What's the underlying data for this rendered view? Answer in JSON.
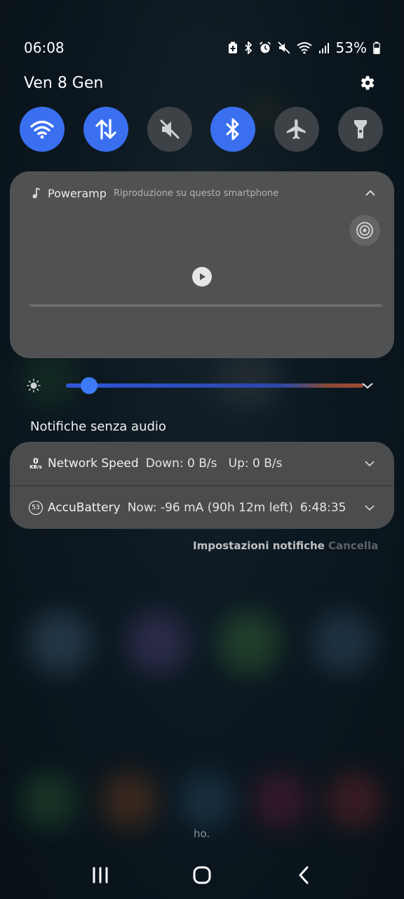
{
  "status_bar": {
    "time": "06:08",
    "battery_percent": "53%",
    "icons": [
      "battery-saver-icon",
      "bluetooth-icon",
      "alarm-icon",
      "mute-icon",
      "wifi-icon",
      "signal-icon",
      "battery-icon"
    ]
  },
  "header": {
    "date": "Ven 8 Gen",
    "settings_icon": "gear-icon"
  },
  "quick_toggles": [
    {
      "name": "wifi",
      "icon": "wifi-icon",
      "state": "on"
    },
    {
      "name": "mobile-data",
      "icon": "data-arrows-icon",
      "state": "on"
    },
    {
      "name": "sound",
      "icon": "mute-icon",
      "state": "off"
    },
    {
      "name": "bluetooth",
      "icon": "bluetooth-icon",
      "state": "on"
    },
    {
      "name": "airplane-mode",
      "icon": "airplane-icon",
      "state": "off"
    },
    {
      "name": "flashlight",
      "icon": "flashlight-icon",
      "state": "off"
    }
  ],
  "media": {
    "app_name": "Poweramp",
    "subtitle": "Riproduzione su questo smartphone",
    "progress": 0
  },
  "brightness": {
    "level": 0.07
  },
  "notifications": {
    "section_label": "Notifiche senza audio",
    "items": [
      {
        "app": "Network Speed",
        "icon_text_top": "0",
        "icon_text_bottom": "KB/s",
        "text": "Down: 0 B/s   Up: 0 B/s"
      },
      {
        "app": "AccuBattery",
        "icon_text": "53",
        "text": "Now: -96 mA (90h 12m left)",
        "time": "6:48:35"
      }
    ],
    "settings_label": "Impostazioni notifiche",
    "clear_label": "Cancella"
  },
  "background_text": "ho.",
  "colors": {
    "accent_on": "#3a6ff0",
    "toggle_off": "#3d4247",
    "card": "#505152",
    "notification_card": "#4a4c4d"
  }
}
